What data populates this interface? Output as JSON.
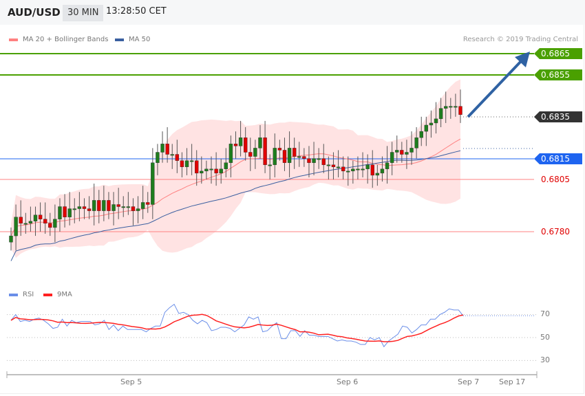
{
  "header": {
    "symbol": "AUD/USD",
    "timeframe": "30 MIN",
    "time": "13:28:50 CET"
  },
  "legend": {
    "ma20": "MA 20 + Bollinger Bands",
    "ma50": "MA 50",
    "rsi": "RSI",
    "ma9": "9MA"
  },
  "credit": "Research © 2019 Trading Central",
  "colors": {
    "up": "#1e7d1e",
    "down": "#e00000",
    "target": "#4aa000",
    "pivot": "#1e64f0",
    "support": "#e00000",
    "last": "#333333",
    "ma50": "#3a5fa0",
    "bb": "#ff8080",
    "rsi": "#6a8ee8",
    "ma9": "#ff2020",
    "arrow": "#2f62a3"
  },
  "levels": {
    "target2": "0.6865",
    "target1": "0.6855",
    "last": "0.6835",
    "pivot": "0.6815",
    "support1": "0.6805",
    "support2": "0.6780"
  },
  "chart_data": [
    {
      "type": "candlestick",
      "title": "AUD/USD 30 MIN",
      "ylim": [
        0.6752,
        0.6878
      ],
      "closes": [
        0.6778,
        0.6787,
        0.6784,
        0.6784,
        0.6785,
        0.6788,
        0.6786,
        0.6784,
        0.6782,
        0.6786,
        0.6792,
        0.6787,
        0.6791,
        0.6791,
        0.6792,
        0.6791,
        0.679,
        0.6795,
        0.679,
        0.6795,
        0.679,
        0.6793,
        0.6792,
        0.6792,
        0.6792,
        0.679,
        0.6791,
        0.6794,
        0.6793,
        0.6813,
        0.6818,
        0.6822,
        0.6817,
        0.6817,
        0.6814,
        0.6811,
        0.6814,
        0.6814,
        0.6808,
        0.6809,
        0.681,
        0.681,
        0.6808,
        0.681,
        0.6813,
        0.6822,
        0.6821,
        0.6825,
        0.6818,
        0.6816,
        0.682,
        0.6825,
        0.6812,
        0.6812,
        0.682,
        0.6819,
        0.6813,
        0.682,
        0.6816,
        0.6816,
        0.6815,
        0.6813,
        0.6815,
        0.6815,
        0.6812,
        0.6812,
        0.6811,
        0.6811,
        0.6809,
        0.6809,
        0.681,
        0.681,
        0.681,
        0.6812,
        0.6807,
        0.6808,
        0.681,
        0.6813,
        0.6818,
        0.6819,
        0.6817,
        0.6818,
        0.682,
        0.6825,
        0.6828,
        0.6831,
        0.6832,
        0.6834,
        0.6839,
        0.684,
        0.684,
        0.684,
        0.6836
      ],
      "forecast": {
        "from": 0.6835,
        "to": 0.6865
      }
    },
    {
      "type": "line",
      "title": "RSI",
      "yticks": [
        30,
        50,
        70
      ],
      "ylim": [
        15,
        95
      ],
      "rsi": [
        65,
        70,
        64,
        65,
        64,
        66,
        67,
        65,
        62,
        58,
        59,
        66,
        60,
        65,
        63,
        64,
        64,
        64,
        61,
        62,
        65,
        57,
        61,
        56,
        60,
        57,
        57,
        57,
        57,
        55,
        58,
        60,
        60,
        72,
        76,
        79,
        71,
        72,
        70,
        65,
        62,
        65,
        63,
        56,
        57,
        59,
        59,
        58,
        55,
        58,
        61,
        68,
        66,
        68,
        55,
        56,
        60,
        63,
        49,
        49,
        56,
        56,
        51,
        56,
        52,
        52,
        51,
        51,
        51,
        49,
        47,
        48,
        47,
        47,
        46,
        44,
        44,
        50,
        48,
        50,
        42,
        47,
        50,
        53,
        60,
        59,
        54,
        57,
        61,
        61,
        66,
        66,
        70,
        72,
        75,
        74,
        74,
        69
      ],
      "xticks": [
        "Sep 5",
        "Sep 6",
        "Sep 7",
        "Sep 17"
      ]
    }
  ]
}
